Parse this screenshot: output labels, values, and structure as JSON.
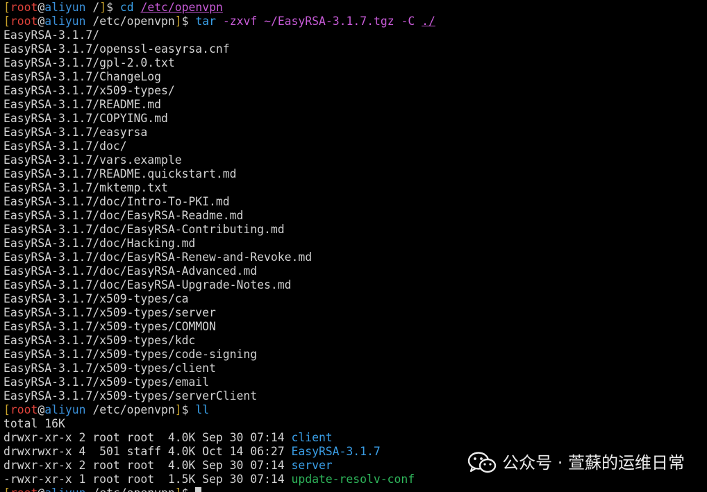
{
  "prompt": {
    "open": "[",
    "user": "root",
    "at": "@",
    "host": "aliyun",
    "close": "]",
    "symbol": "$"
  },
  "commands": [
    {
      "cwd": "/",
      "cmd": "cd",
      "args": [
        "/etc/openvpn"
      ]
    },
    {
      "cwd": "/etc/openvpn",
      "cmd": "tar",
      "args": [
        "-zxvf",
        "~/EasyRSA-3.1.7.tgz",
        "-C",
        "./"
      ]
    },
    {
      "cwd": "/etc/openvpn",
      "cmd": "ll",
      "args": []
    },
    {
      "cwd": "/etc/openvpn",
      "cmd": "",
      "args": []
    }
  ],
  "tar_output": [
    "EasyRSA-3.1.7/",
    "EasyRSA-3.1.7/openssl-easyrsa.cnf",
    "EasyRSA-3.1.7/gpl-2.0.txt",
    "EasyRSA-3.1.7/ChangeLog",
    "EasyRSA-3.1.7/x509-types/",
    "EasyRSA-3.1.7/README.md",
    "EasyRSA-3.1.7/COPYING.md",
    "EasyRSA-3.1.7/easyrsa",
    "EasyRSA-3.1.7/doc/",
    "EasyRSA-3.1.7/vars.example",
    "EasyRSA-3.1.7/README.quickstart.md",
    "EasyRSA-3.1.7/mktemp.txt",
    "EasyRSA-3.1.7/doc/Intro-To-PKI.md",
    "EasyRSA-3.1.7/doc/EasyRSA-Readme.md",
    "EasyRSA-3.1.7/doc/EasyRSA-Contributing.md",
    "EasyRSA-3.1.7/doc/Hacking.md",
    "EasyRSA-3.1.7/doc/EasyRSA-Renew-and-Revoke.md",
    "EasyRSA-3.1.7/doc/EasyRSA-Advanced.md",
    "EasyRSA-3.1.7/doc/EasyRSA-Upgrade-Notes.md",
    "EasyRSA-3.1.7/x509-types/ca",
    "EasyRSA-3.1.7/x509-types/server",
    "EasyRSA-3.1.7/x509-types/COMMON",
    "EasyRSA-3.1.7/x509-types/kdc",
    "EasyRSA-3.1.7/x509-types/code-signing",
    "EasyRSA-3.1.7/x509-types/client",
    "EasyRSA-3.1.7/x509-types/email",
    "EasyRSA-3.1.7/x509-types/serverClient"
  ],
  "ll_output": {
    "total": "total 16K",
    "entries": [
      {
        "meta": "drwxr-xr-x 2 root root  4.0K Sep 30 07:14 ",
        "name": "client",
        "kind": "dir"
      },
      {
        "meta": "drwxrwxr-x 4  501 staff 4.0K Oct 14 06:27 ",
        "name": "EasyRSA-3.1.7",
        "kind": "dir"
      },
      {
        "meta": "drwxr-xr-x 2 root root  4.0K Sep 30 07:14 ",
        "name": "server",
        "kind": "dir"
      },
      {
        "meta": "-rwxr-xr-x 1 root root  1.5K Sep 30 07:14 ",
        "name": "update-resolv-conf",
        "kind": "exe"
      }
    ]
  },
  "watermark": {
    "text": "公众号 · 萱蘇的运维日常",
    "icon": "wechat-icon"
  },
  "colors": {
    "background": "#000000",
    "text": "#d3d3d3",
    "bracket": "#c6a02a",
    "user": "#e0433b",
    "host": "#3a8fd8",
    "command": "#3aa0e8",
    "argument": "#c85bd8",
    "directory": "#3a9fe8",
    "executable": "#2fb85c"
  }
}
